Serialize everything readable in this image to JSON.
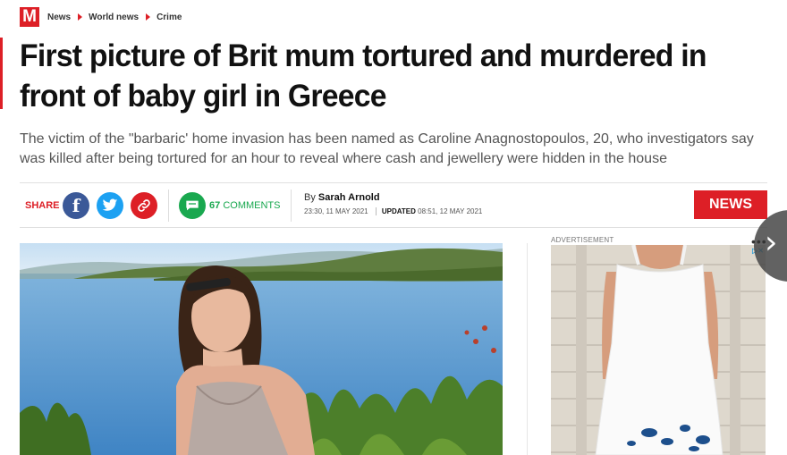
{
  "breadcrumb": {
    "logo": "M",
    "items": [
      "News",
      "World news",
      "Crime"
    ]
  },
  "article": {
    "headline": "First picture of Brit mum tortured and murdered in front of baby girl in Greece",
    "standfirst": "The victim of the \"barbaric' home invasion has been named as Caroline Anagnostopoulos, 20, who investigators say was killed after being tortured for an hour to reveal where cash and jewellery were hidden in the house",
    "share_label": "SHARE",
    "comments_count": "67",
    "comments_label": "COMMENTS",
    "byline_prefix": "By",
    "author": "Sarah Arnold",
    "published": "23:30, 11 MAY 2021",
    "updated_label": "UPDATED",
    "updated": "08:51, 12 MAY 2021",
    "section_badge": "NEWS"
  },
  "advert": {
    "label": "ADVERTISEMENT",
    "choices": "▷✕"
  },
  "controls": {
    "next_arrow": "›",
    "more_dots": "•••"
  },
  "colors": {
    "brand": "#dd1f26",
    "facebook": "#3b5998",
    "twitter": "#1da1f2",
    "comments": "#19a84f"
  }
}
